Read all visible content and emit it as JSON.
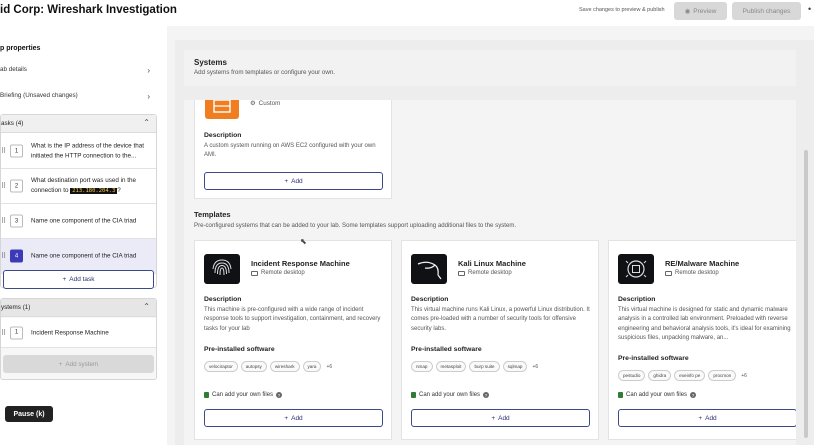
{
  "header": {
    "title": "id Corp: Wireshark Investigation",
    "save_hint": "Save changes to preview & publish",
    "preview_label": "Preview",
    "publish_label": "Publish changes",
    "more_icon": "more-icon"
  },
  "sidebar": {
    "title": "p properties",
    "lab_details": "ab details",
    "briefing": "Briefing (Unsaved changes)",
    "tasks_header": "asks (4)",
    "tasks": [
      {
        "num": "1",
        "text": "What is the IP address of the device that initiated the HTTP connection to the..."
      },
      {
        "num": "2",
        "text_a": "What destination port was used in the connection to ",
        "ip": "213.180.204.3",
        "text_b": "?"
      },
      {
        "num": "3",
        "text": "Name one component of the CIA triad"
      },
      {
        "num": "4",
        "text": "Name one component of the CIA triad"
      }
    ],
    "add_task": "Add task",
    "systems_header": "ystems (1)",
    "systems": [
      {
        "num": "1",
        "text": "Incident Response Machine"
      }
    ],
    "add_system": "Add system",
    "pause_label": "Pause (k)"
  },
  "main": {
    "systems_title": "Systems",
    "systems_sub": "Add systems from templates or configure your own.",
    "custom": {
      "badge": "Custom",
      "desc_title": "Description",
      "desc": "A custom system running on AWS EC2 configured with your own AMI.",
      "add": "Add"
    },
    "templates_title": "Templates",
    "templates_sub": "Pre-configured systems that can be added to your lab. Some templates support uploading additional files to the system.",
    "templates": [
      {
        "name": "Incident Response Machine",
        "kind": "Remote desktop",
        "desc_title": "Description",
        "desc": "This machine is pre-configured with a wide range of incident response tools to support investigation, containment, and recovery tasks for your lab",
        "software_title": "Pre-installed software",
        "tags": [
          "velociraptor",
          "autopsy",
          "wireshark",
          "yara"
        ],
        "more": "+6",
        "files": "Can add your own files",
        "add": "Add"
      },
      {
        "name": "Kali Linux Machine",
        "kind": "Remote desktop",
        "desc_title": "Description",
        "desc": "This virtual machine runs Kali Linux, a powerful Linux distribution. It comes pre-loaded with a number of security tools for offensive security labs.",
        "software_title": "Pre-installed software",
        "tags": [
          "nmap",
          "metasploit",
          "burp suite",
          "sqlmap"
        ],
        "more": "+6",
        "files": "Can add your own files",
        "add": "Add"
      },
      {
        "name": "RE/Malware Machine",
        "kind": "Remote desktop",
        "desc_title": "Description",
        "desc": "This virtual machine is designed for static and dynamic malware analysis in a controlled lab environment. Preloaded with reverse engineering and behavioral analysis tools, it's ideal for examining suspicious files, unpacking malware, an...",
        "software_title": "Pre-installed software",
        "tags": [
          "pestudio",
          "ghidra",
          "exeinfo pe",
          "procmon"
        ],
        "more": "+6",
        "files": "Can add your own files",
        "add": "Add"
      }
    ]
  }
}
